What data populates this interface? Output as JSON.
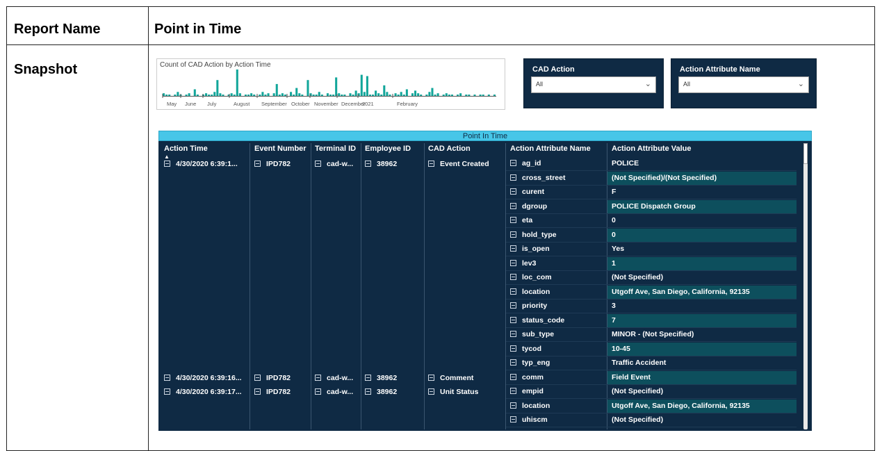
{
  "document": {
    "row1_label": "Report Name",
    "row1_value": "Point in Time",
    "row2_label": "Snapshot"
  },
  "chart_data": {
    "type": "bar",
    "title": "Count of CAD Action by Action Time",
    "x_tick_labels": [
      "May",
      "June",
      "July",
      "August",
      "September",
      "October",
      "November",
      "December",
      "2021",
      "February"
    ],
    "bar_color": "#12a69a",
    "values": [
      2,
      1,
      1,
      0,
      1,
      3,
      1,
      0,
      1,
      2,
      0,
      5,
      1,
      0,
      1,
      2,
      1,
      1,
      3,
      12,
      2,
      1,
      0,
      1,
      2,
      1,
      20,
      2,
      0,
      1,
      1,
      2,
      1,
      0,
      1,
      3,
      1,
      2,
      0,
      2,
      9,
      1,
      2,
      1,
      0,
      3,
      1,
      6,
      2,
      1,
      0,
      12,
      2,
      1,
      1,
      3,
      1,
      0,
      2,
      1,
      1,
      14,
      2,
      1,
      1,
      0,
      2,
      1,
      4,
      2,
      16,
      3,
      15,
      1,
      1,
      4,
      2,
      1,
      8,
      3,
      1,
      0,
      2,
      1,
      3,
      1,
      5,
      0,
      2,
      4,
      2,
      1,
      0,
      1,
      3,
      6,
      1,
      2,
      0,
      1,
      2,
      1,
      1,
      0,
      1,
      2,
      0,
      1,
      1,
      0,
      1,
      0,
      1,
      1,
      0,
      1,
      0,
      1
    ],
    "ylim": [
      0,
      20
    ],
    "grid": false
  },
  "slicers": [
    {
      "title": "CAD Action",
      "value": "All"
    },
    {
      "title": "Action Attribute Name",
      "value": "All"
    }
  ],
  "table": {
    "title": "Point In Time",
    "columns": [
      "Action Time",
      "Event Number",
      "Terminal ID",
      "Employee ID",
      "CAD Action",
      "Action Attribute Name",
      "Action Attribute Value"
    ],
    "sort_indicator": "▲",
    "events": [
      {
        "time": "4/30/2020 6:39:1...",
        "event_number": "IPD782",
        "terminal_id": "cad-w...",
        "employee_id": "38962",
        "cad_action": "Event Created"
      },
      {
        "time": "4/30/2020 6:39:16...",
        "event_number": "IPD782",
        "terminal_id": "cad-w...",
        "employee_id": "38962",
        "cad_action": "Comment"
      },
      {
        "time": "4/30/2020 6:39:17...",
        "event_number": "IPD782",
        "terminal_id": "cad-w...",
        "employee_id": "38962",
        "cad_action": "Unit Status"
      }
    ],
    "attributes": [
      {
        "name": "ag_id",
        "value": "POLICE"
      },
      {
        "name": "cross_street",
        "value": "(Not Specified)/(Not Specified)"
      },
      {
        "name": "curent",
        "value": "F"
      },
      {
        "name": "dgroup",
        "value": "POLICE Dispatch Group"
      },
      {
        "name": "eta",
        "value": "0"
      },
      {
        "name": "hold_type",
        "value": "0"
      },
      {
        "name": "is_open",
        "value": "Yes"
      },
      {
        "name": "lev3",
        "value": "1"
      },
      {
        "name": "loc_com",
        "value": "(Not Specified)"
      },
      {
        "name": "location",
        "value": "Utgoff Ave, San Diego, California, 92135"
      },
      {
        "name": "priority",
        "value": "3"
      },
      {
        "name": "status_code",
        "value": "7"
      },
      {
        "name": "sub_type",
        "value": "MINOR - (Not Specified)"
      },
      {
        "name": "tycod",
        "value": "10-45"
      },
      {
        "name": "typ_eng",
        "value": "Traffic Accident"
      },
      {
        "name": "comm",
        "value": "Field Event"
      },
      {
        "name": "empid",
        "value": "(Not Specified)"
      },
      {
        "name": "location",
        "value": "Utgoff Ave, San Diego, California, 92135"
      },
      {
        "name": "uhiscm",
        "value": "(Not Specified)"
      }
    ]
  }
}
